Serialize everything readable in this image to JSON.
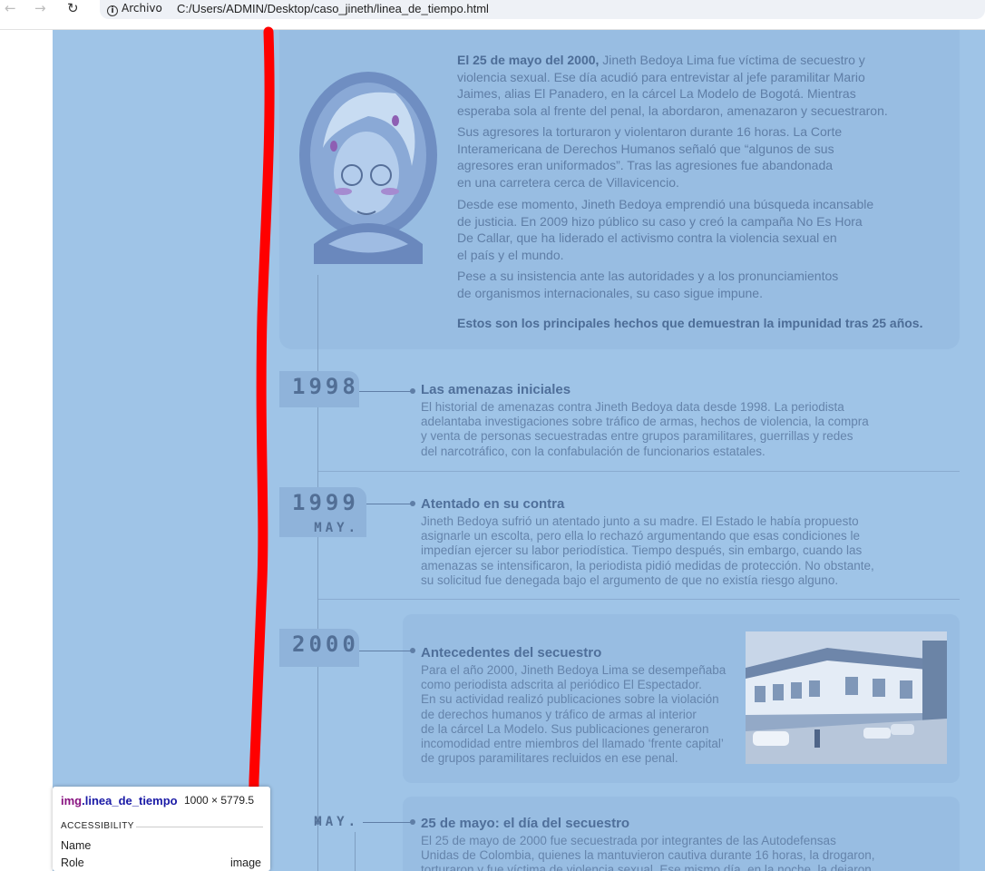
{
  "browser": {
    "url_chip": "Archivo",
    "url": "C:/Users/ADMIN/Desktop/caso_jineth/linea_de_tiempo.html"
  },
  "intro": {
    "p1_bold": "El 25 de mayo del 2000,",
    "p1_lines": [
      " Jineth Bedoya Lima fue víctima de secuestro y",
      "violencia sexual. Ese día acudió para entrevistar al jefe paramilitar Mario",
      "Jaimes, alias El Panadero, en la cárcel La Modelo de Bogotá. Mientras",
      "esperaba sola al frente del penal, la abordaron, amenazaron y secuestraron."
    ],
    "p2_lines": [
      "Sus agresores la torturaron y violentaron durante 16 horas. La Corte",
      "Interamericana de Derechos Humanos señaló que “algunos de sus",
      "agresores eran uniformados”. Tras las agresiones fue abandonada",
      "en una carretera cerca de Villavicencio."
    ],
    "p3_lines": [
      "Desde ese momento, Jineth Bedoya emprendió una búsqueda incansable",
      "de justicia. En 2009 hizo público su caso y creó la campaña No Es Hora",
      "De Callar, que ha liderado el activismo contra la violencia sexual en",
      "el país y el mundo."
    ],
    "p4_lines": [
      "Pese a su insistencia ante las autoridades y a los pronunciamientos",
      "de organismos internacionales, su caso sigue impune."
    ],
    "closing": "Estos son los principales hechos que demuestran la impunidad tras 25 años."
  },
  "events": [
    {
      "year": "1998",
      "month": "",
      "title": "Las amenazas iniciales",
      "body": [
        "El historial de amenazas contra Jineth Bedoya data desde 1998. La periodista",
        "adelantaba investigaciones sobre tráfico de armas, hechos de violencia, la compra",
        "y venta de personas secuestradas entre grupos paramilitares, guerrillas y redes",
        "del narcotráfico, con la confabulación de funcionarios estatales."
      ]
    },
    {
      "year": "1999",
      "month": "MAY.",
      "title": "Atentado en su contra",
      "body": [
        "Jineth Bedoya sufrió un atentado junto a su madre. El Estado le había propuesto",
        "asignarle un escolta, pero ella lo rechazó argumentando que esas condiciones le",
        "impedían ejercer su labor periodística. Tiempo después, sin embargo, cuando las",
        "amenazas se intensificaron, la periodista pidió medidas de protección. No obstante,",
        "su solicitud fue denegada bajo el argumento de que no existía riesgo alguno."
      ]
    },
    {
      "year": "2000",
      "month": "",
      "title": "Antecedentes del secuestro",
      "body": [
        "Para el año 2000, Jineth Bedoya Lima se desempeñaba",
        "como periodista adscrita al periódico El Espectador.",
        "En su actividad realizó publicaciones sobre la violación",
        "de derechos humanos y tráfico de armas al interior",
        "de la cárcel La Modelo. Sus publicaciones generaron",
        "incomodidad entre miembros del llamado ‘frente capital’",
        "de grupos paramilitares recluidos en ese penal."
      ]
    },
    {
      "year": "",
      "month": "MAY.",
      "title": "25 de mayo: el día del secuestro",
      "body": [
        "El 25 de mayo de 2000 fue secuestrada por integrantes de las Autodefensas",
        "Unidas de Colombia, quienes la mantuvieron cautiva durante 16 horas, la drogaron,",
        "torturaron y fue víctima de violencia sexual.  Ese mismo día, en la noche, la dejaron"
      ]
    }
  ],
  "tooltip": {
    "tag": "img",
    "cls": ".linea_de_tiempo",
    "size": "1000 × 5779.5",
    "section": "ACCESSIBILITY",
    "rows": [
      {
        "label": "Name",
        "value": ""
      },
      {
        "label": "Role",
        "value": "image"
      }
    ]
  }
}
